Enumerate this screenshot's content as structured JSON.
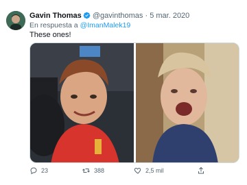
{
  "tweet": {
    "author_name": "Gavin Thomas",
    "handle": "@gavinthomas",
    "separator": "·",
    "date": "5 mar. 2020",
    "reply_prefix": "En respuesta a",
    "reply_mention": "@ImanMalek19",
    "text": "These ones!"
  },
  "media": {
    "images": [
      {
        "name": "smiling-kid-photo"
      },
      {
        "name": "screaming-kid-photo"
      }
    ]
  },
  "actions": {
    "replies": "23",
    "retweets": "388",
    "likes": "2,5 mil"
  },
  "colors": {
    "accent": "#1d9bf0",
    "text": "#0f1419",
    "muted": "#536471"
  },
  "icons": [
    "verified-badge-icon",
    "reply-icon",
    "retweet-icon",
    "like-icon",
    "share-icon"
  ]
}
